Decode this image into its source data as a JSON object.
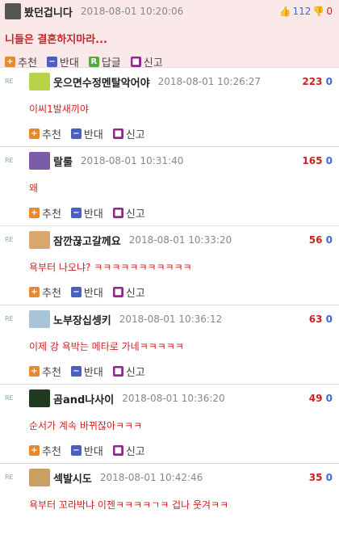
{
  "post": {
    "author": "봤던겁니다",
    "time": "2018-08-01 10:20:06",
    "up": "112",
    "down": "0",
    "title": "니들은 결혼하지마라...",
    "actions": {
      "recommend": "추천",
      "oppose": "반대",
      "reply": "답글",
      "report": "신고"
    },
    "reply_icon_letter": "R"
  },
  "comments": [
    {
      "author": "웃으면수정멘탈악어야",
      "time": "2018-08-01 10:26:27",
      "score_a": "223",
      "score_b": "0",
      "text": "이씨1발새끼야"
    },
    {
      "author": "랄룰",
      "time": "2018-08-01 10:31:40",
      "score_a": "165",
      "score_b": "0",
      "text": "왜"
    },
    {
      "author": "잠깐끊고갈께요",
      "time": "2018-08-01 10:33:20",
      "score_a": "56",
      "score_b": "0",
      "text": "욕부터 나오냐? ㅋㅋㅋㅋㅋㅋㅋㅋㅋㅋㅋ"
    },
    {
      "author": "노부장십셍키",
      "time": "2018-08-01 10:36:12",
      "score_a": "63",
      "score_b": "0",
      "text": "이제 강 욕박는 메타로 가네ㅋㅋㅋㅋㅋ"
    },
    {
      "author": "곰and나사이",
      "time": "2018-08-01 10:36:20",
      "score_a": "49",
      "score_b": "0",
      "text": "순서가 계속 바뀌잖아ㅋㅋㅋ"
    },
    {
      "author": "섹발시도",
      "time": "2018-08-01 10:42:46",
      "score_a": "35",
      "score_b": "0",
      "text": "욕부터 꼬라박냐 이젠ㅋㅋㅋㅋㄱㅋ 겁나 웃겨ㅋㅋ"
    }
  ],
  "comment_actions": {
    "recommend": "추천",
    "oppose": "반대",
    "report": "신고"
  },
  "re_label": "RE",
  "icons": {
    "recommend": "plus-icon",
    "oppose": "minus-icon",
    "report": "siren-icon"
  }
}
